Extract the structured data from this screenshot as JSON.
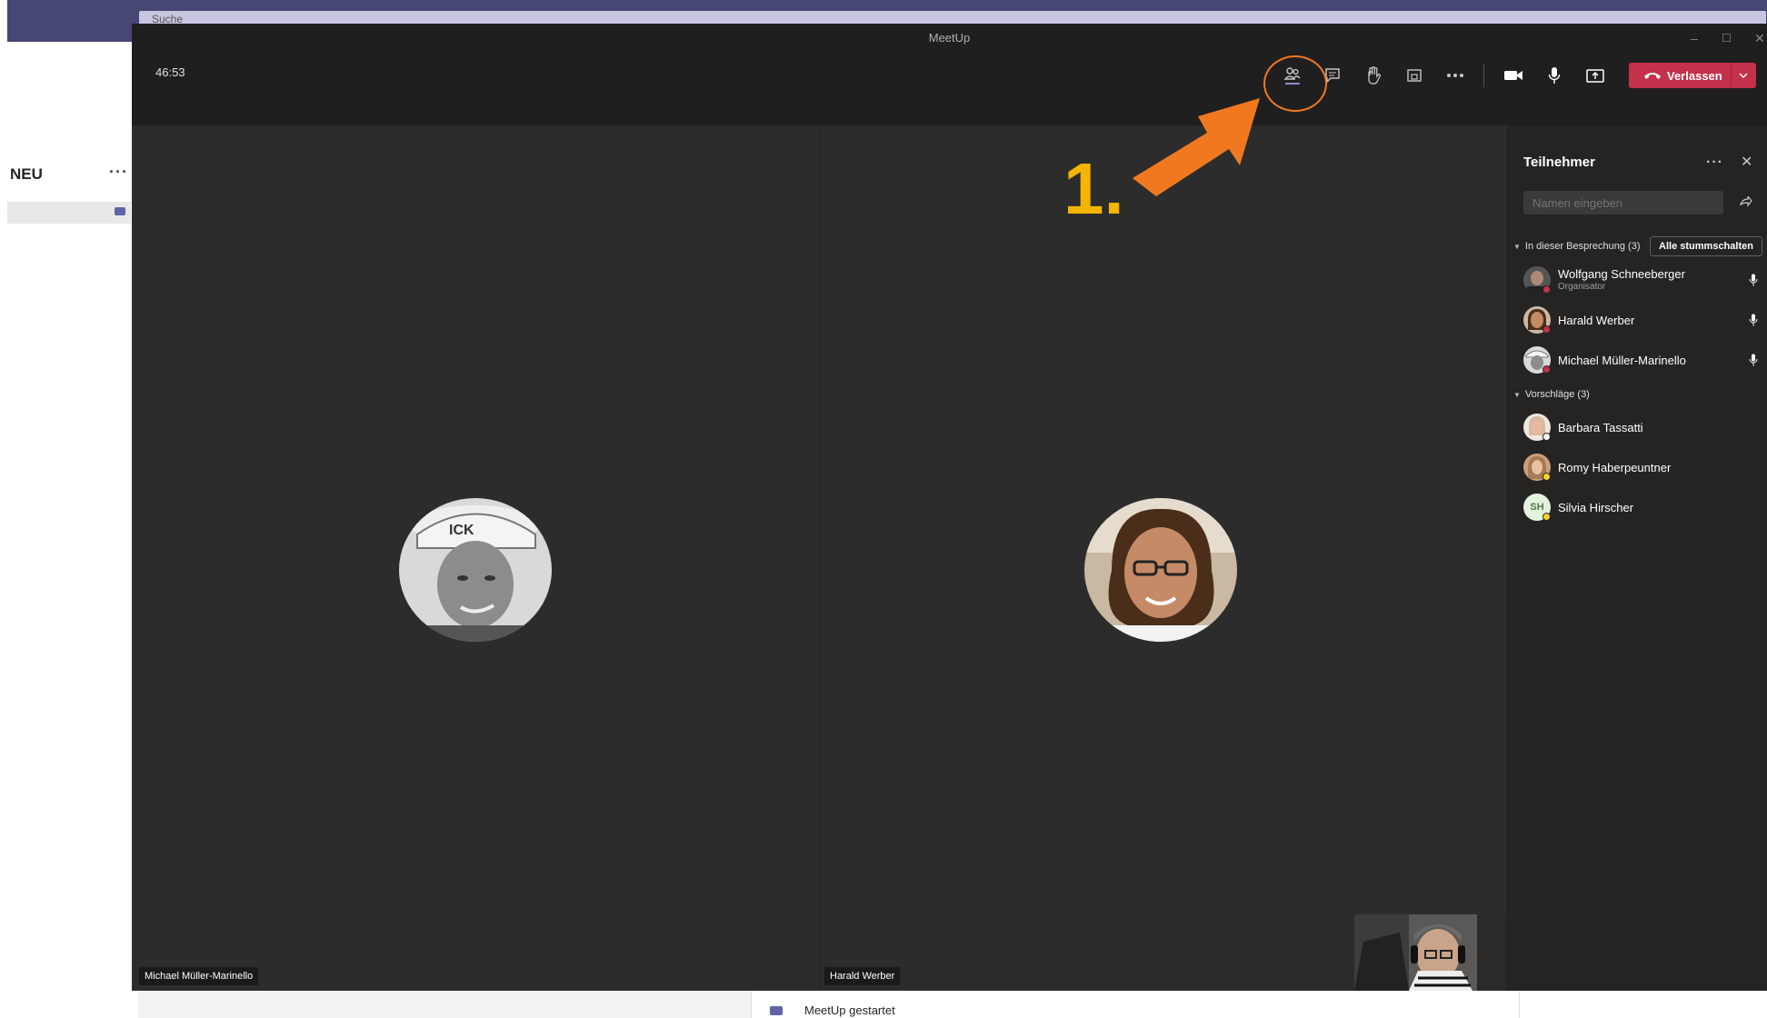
{
  "background_app": {
    "search_placeholder": "Suche",
    "section_title": "NEU",
    "section_more": "···",
    "chat_status": "MeetUp gestartet"
  },
  "window": {
    "title": "MeetUp",
    "minimize": "–",
    "maximize": "☐",
    "close": "✕"
  },
  "toolbar": {
    "timer": "46:53",
    "leave_label": "Verlassen",
    "active_tool": "participants"
  },
  "stage": {
    "tiles": [
      {
        "name": "Michael Müller-Marinello"
      },
      {
        "name": "Harald Werber"
      }
    ]
  },
  "annotation": {
    "label": "1.",
    "color": "#f0791f",
    "label_color": "#f5b400"
  },
  "panel": {
    "title": "Teilnehmer",
    "more": "···",
    "close": "✕",
    "search_placeholder": "Namen eingeben",
    "in_meeting_label": "In dieser Besprechung (3)",
    "mute_all_label": "Alle stummschalten",
    "in_meeting": [
      {
        "name": "Wolfgang Schneeberger",
        "role": "Organisator",
        "status": "#c4314b"
      },
      {
        "name": "Harald Werber",
        "role": "",
        "status": "#c4314b"
      },
      {
        "name": "Michael Müller-Marinello",
        "role": "",
        "status": "#c4314b"
      }
    ],
    "suggestions_label": "Vorschläge (3)",
    "suggestions": [
      {
        "name": "Barbara Tassatti",
        "initials": "",
        "status": "#ffffff"
      },
      {
        "name": "Romy Haberpeuntner",
        "initials": "",
        "status": "#f8d22a"
      },
      {
        "name": "Silvia Hirscher",
        "initials": "SH",
        "status": "#f8d22a"
      }
    ]
  },
  "colors": {
    "accent": "#6264a7",
    "leave": "#c4314b",
    "window_bg": "#2d2c2c",
    "toolbar_bg": "#201f1f"
  }
}
